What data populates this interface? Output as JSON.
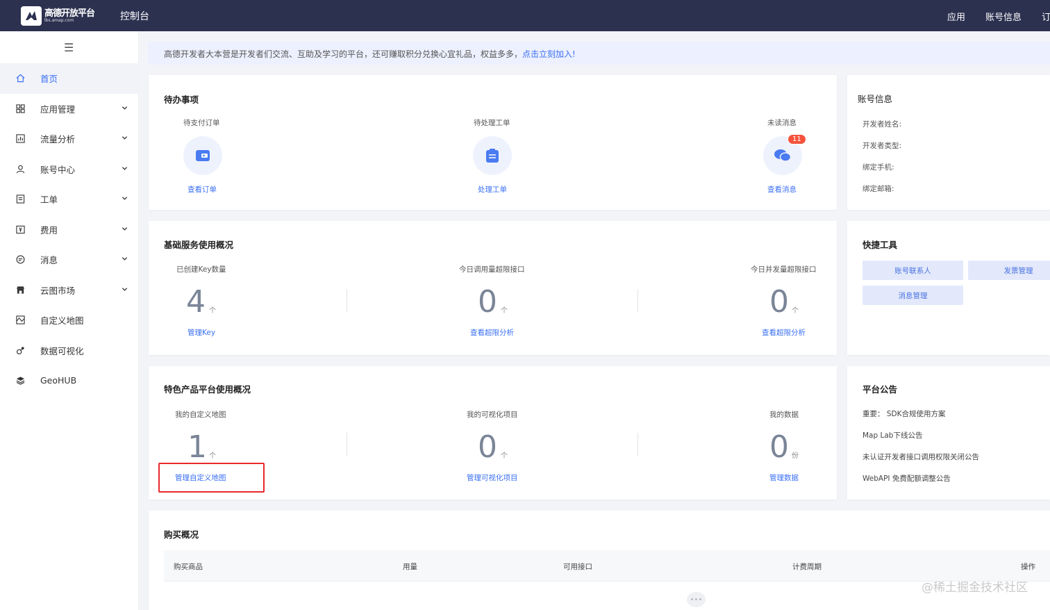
{
  "header": {
    "logo_name": "高德开放平台",
    "logo_url": "lbs.amap.com",
    "console": "控制台",
    "nav": [
      "应用",
      "账号信息",
      "订单"
    ]
  },
  "sidebar": {
    "items": [
      {
        "label": "首页",
        "icon": "home-icon",
        "active": true,
        "expandable": false
      },
      {
        "label": "应用管理",
        "icon": "apps-icon",
        "expandable": true
      },
      {
        "label": "流量分析",
        "icon": "chart-icon",
        "expandable": true
      },
      {
        "label": "账号中心",
        "icon": "user-icon",
        "expandable": true
      },
      {
        "label": "工单",
        "icon": "ticket-icon",
        "expandable": true
      },
      {
        "label": "费用",
        "icon": "fee-icon",
        "expandable": true
      },
      {
        "label": "消息",
        "icon": "message-icon",
        "expandable": true
      },
      {
        "label": "云图市场",
        "icon": "store-icon",
        "expandable": true
      },
      {
        "label": "自定义地图",
        "icon": "map-icon",
        "expandable": false
      },
      {
        "label": "数据可视化",
        "icon": "dataviz-icon",
        "expandable": false
      },
      {
        "label": "GeoHUB",
        "icon": "layers-icon",
        "expandable": false
      }
    ]
  },
  "banner": {
    "text": "高德开发者大本营是开发者们交流、互助及学习的平台，还可赚取积分兑换心宜礼品，权益多多，",
    "link": "点击立刻加入!"
  },
  "todo": {
    "title": "待办事项",
    "items": [
      {
        "label": "待支付订单",
        "link": "查看订单",
        "icon": "wallet-icon"
      },
      {
        "label": "待处理工单",
        "link": "处理工单",
        "icon": "clipboard-icon"
      },
      {
        "label": "未读消息",
        "link": "查看消息",
        "icon": "chat-icon",
        "badge": "11"
      }
    ]
  },
  "account": {
    "title": "账号信息",
    "fields": [
      "开发者姓名:",
      "开发者类型:",
      "绑定手机:",
      "绑定邮箱:"
    ]
  },
  "basic": {
    "title": "基础服务使用概况",
    "stats": [
      {
        "label": "已创建Key数量",
        "value": "4",
        "unit": "个",
        "link": "管理Key"
      },
      {
        "label": "今日调用量超限接口",
        "value": "0",
        "unit": "个",
        "link": "查看超限分析"
      },
      {
        "label": "今日并发量超限接口",
        "value": "0",
        "unit": "个",
        "link": "查看超限分析"
      }
    ]
  },
  "quick": {
    "title": "快捷工具",
    "buttons": [
      "账号联系人",
      "发票管理",
      "消息管理"
    ]
  },
  "featured": {
    "title": "特色产品平台使用概况",
    "stats": [
      {
        "label": "我的自定义地图",
        "value": "1",
        "unit": "个",
        "link": "管理自定义地图"
      },
      {
        "label": "我的可视化项目",
        "value": "0",
        "unit": "个",
        "link": "管理可视化项目"
      },
      {
        "label": "我的数据",
        "value": "0",
        "unit": "份",
        "link": "管理数据"
      }
    ]
  },
  "notice": {
    "title": "平台公告",
    "items": [
      "重要： SDK合规使用方案",
      "Map Lab下线公告",
      "未认证开发者接口调用权限关闭公告",
      "WebAPI 免费配额调整公告"
    ]
  },
  "purchase": {
    "title": "购买概况",
    "columns": [
      "购买商品",
      "用量",
      "可用接口",
      "计费周期",
      "操作"
    ]
  },
  "watermark": "@稀土掘金技术社区",
  "colors": {
    "topbar": "#2c3150",
    "accent": "#3a6ff3",
    "badge": "#f5533d",
    "highlight": "#e8282b"
  }
}
